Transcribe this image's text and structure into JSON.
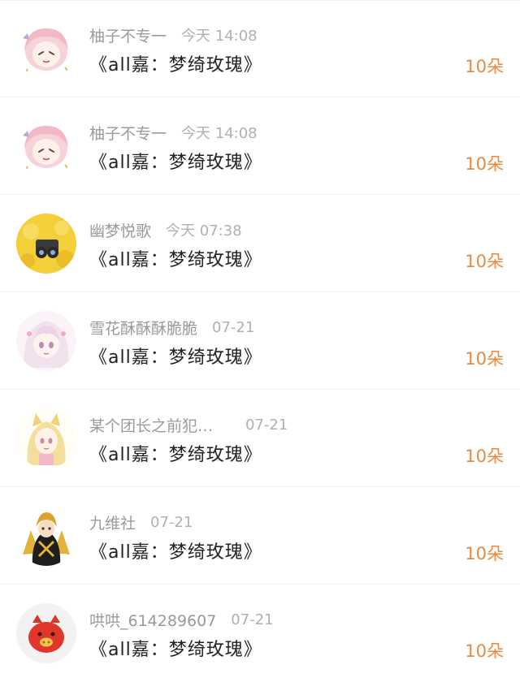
{
  "accent_color": "#e88a3d",
  "entries": [
    {
      "avatar_icon": "anime-girl-pink-hair-icon",
      "username": "柚子不专一",
      "time": "今天 14:08",
      "title": "《all嘉：梦绮玫瑰》",
      "gift": "10朵"
    },
    {
      "avatar_icon": "anime-girl-pink-hair-icon",
      "username": "柚子不专一",
      "time": "今天 14:08",
      "title": "《all嘉：梦绮玫瑰》",
      "gift": "10朵"
    },
    {
      "avatar_icon": "yellow-plush-binoculars-icon",
      "username": "幽梦悦歌",
      "time": "今天 07:38",
      "title": "《all嘉：梦绮玫瑰》",
      "gift": "10朵"
    },
    {
      "avatar_icon": "anime-girl-white-hair-icon",
      "username": "雪花酥酥酥脆脆",
      "time": "07-21",
      "title": "《all嘉：梦绮玫瑰》",
      "gift": "10朵"
    },
    {
      "avatar_icon": "anime-catgirl-blonde-icon",
      "username": "某个团长之前犯…",
      "time": "07-21",
      "title": "《all嘉：梦绮玫瑰》",
      "gift": "10朵"
    },
    {
      "avatar_icon": "anime-character-black-gold-icon",
      "username": "九维社",
      "time": "07-21",
      "title": "《all嘉：梦绮玫瑰》",
      "gift": "10朵"
    },
    {
      "avatar_icon": "red-pig-icon",
      "username": "哄哄_614289607",
      "time": "07-21",
      "title": "《all嘉：梦绮玫瑰》",
      "gift": "10朵"
    }
  ]
}
